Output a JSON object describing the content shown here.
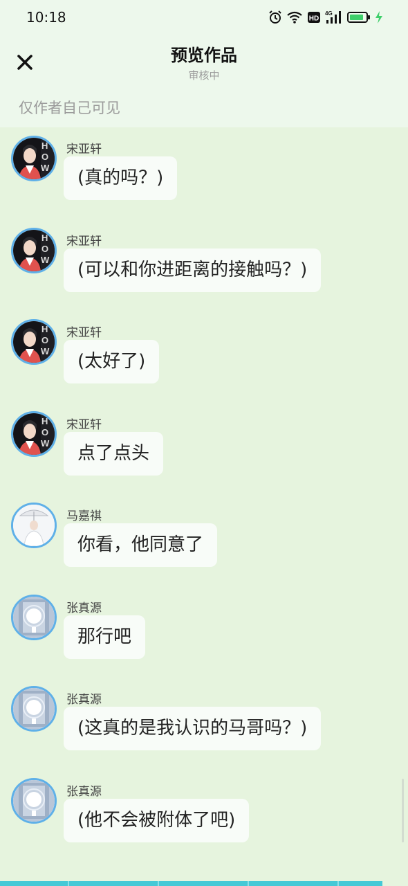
{
  "status_bar": {
    "time": "10:18",
    "network_label": "4G",
    "hd_label": "HD",
    "icons": [
      "alarm-icon",
      "wifi-icon",
      "hd-icon",
      "signal-icon",
      "battery-icon",
      "charging-icon"
    ]
  },
  "header": {
    "title": "预览作品",
    "subtitle": "审核中",
    "visibility_note": "仅作者自己可见",
    "close_icon": "close-icon"
  },
  "colors": {
    "background": "#e6f4de",
    "header_background": "#edf8ec",
    "bubble": "#f8fcf8",
    "avatar_border": "#5fb0e8",
    "battery": "#3ecf6a",
    "bottom_strip": "#45c9d6"
  },
  "messages": [
    {
      "sender": "宋亚轩",
      "text": "(真的吗？)",
      "avatar": "songyaxuan"
    },
    {
      "sender": "宋亚轩",
      "text": "(可以和你进距离的接触吗？)",
      "avatar": "songyaxuan"
    },
    {
      "sender": "宋亚轩",
      "text": "(太好了)",
      "avatar": "songyaxuan"
    },
    {
      "sender": "宋亚轩",
      "text": "点了点头",
      "avatar": "songyaxuan"
    },
    {
      "sender": "马嘉祺",
      "text": "你看，他同意了",
      "avatar": "majiaqi"
    },
    {
      "sender": "张真源",
      "text": "那行吧",
      "avatar": "zhangzhenyuan"
    },
    {
      "sender": "张真源",
      "text": "(这真的是我认识的马哥吗？)",
      "avatar": "zhangzhenyuan"
    },
    {
      "sender": "张真源",
      "text": "(他不会被附体了吧)",
      "avatar": "zhangzhenyuan"
    }
  ]
}
